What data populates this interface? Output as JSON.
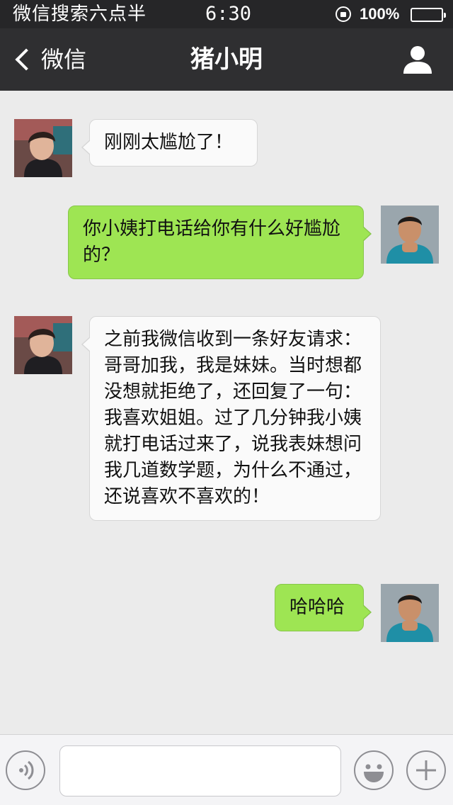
{
  "status_bar": {
    "carrier": "微信搜索六点半",
    "time": "6:30",
    "battery": "100%"
  },
  "nav": {
    "back_label": "微信",
    "title": "猪小明"
  },
  "messages": [
    {
      "side": "in",
      "text": "刚刚太尴尬了！"
    },
    {
      "side": "out",
      "text": "你小姨打电话给你有什么好尴尬的？"
    },
    {
      "side": "in",
      "text": "之前我微信收到一条好友请求：哥哥加我，我是妹妹。当时想都没想就拒绝了，还回复了一句：我喜欢姐姐。过了几分钟我小姨就打电话过来了，说我表妹想问我几道数学题，为什么不通过，还说喜欢不喜欢的！"
    },
    {
      "side": "out",
      "text": "哈哈哈"
    }
  ],
  "input_bar": {
    "message_value": "",
    "icons": [
      "voice-icon",
      "emoji-icon",
      "plus-icon"
    ]
  },
  "colors": {
    "status_bg": "#262628",
    "nav_bg": "#2f2f31",
    "chat_bg": "#ebebeb",
    "incoming_bubble": "#fafafa",
    "outgoing_bubble": "#9ee553"
  }
}
